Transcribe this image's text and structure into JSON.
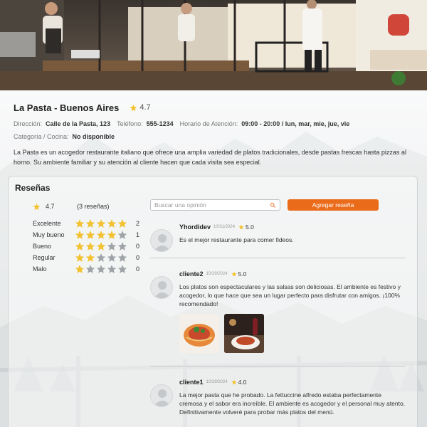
{
  "restaurant": {
    "name": "La Pasta - Buenos Aires",
    "rating": "4.7",
    "address_label": "Dirección:",
    "address": "Calle de la Pasta, 123",
    "phone_label": "Teléfono:",
    "phone": "555-1234",
    "hours_label": "Horario de Atención:",
    "hours": "09:00 - 20:00 / lun, mar, mie, jue, vie",
    "category_label": "Categoría / Cocina:",
    "category": "No disponible",
    "description": "La Pasta es un acogedor restaurante italiano que ofrece una amplia variedad de platos tradicionales, desde pastas frescas hasta pizzas al horno. Su ambiente familiar y su atención al cliente hacen que cada visita sea especial."
  },
  "reviews_section": {
    "title": "Reseñas",
    "average": "4.7",
    "count_text": "(3 reseñas)",
    "distribution": [
      {
        "label": "Excelente",
        "stars": 5,
        "count": "2"
      },
      {
        "label": "Muy bueno",
        "stars": 4,
        "count": "1"
      },
      {
        "label": "Bueno",
        "stars": 3,
        "count": "0"
      },
      {
        "label": "Regular",
        "stars": 2,
        "count": "0"
      },
      {
        "label": "Malo",
        "stars": 1,
        "count": "0"
      }
    ],
    "search_placeholder": "Buscar una opinión",
    "add_button": "Agregar reseña",
    "reviews": [
      {
        "user": "Yhordidev",
        "date": "10/31/2024",
        "rating": "5.0",
        "text": "Es el mejor restaurante para comer fideos."
      },
      {
        "user": "cliente2",
        "date": "10/29/2024",
        "rating": "5.0",
        "text": "Los platos son espectaculares y las salsas son deliciosas. El ambiente es festivo y acogedor, lo que hace que sea un lugar perfecto para disfrutar con amigos. ¡100% recomendado!"
      },
      {
        "user": "cliente1",
        "date": "10/29/2024",
        "rating": "4.0",
        "text": "La mejor pasta que he probado. La fettuccine alfredo estaba perfectamente cremosa y el sabor era increíble. El ambiente es acogedor y el personal muy atento. Definitivamente volveré para probar más platos del menú."
      }
    ]
  },
  "colors": {
    "accent": "#ea6c1b",
    "star_filled": "#f2c230",
    "star_empty": "#9ea3a7"
  },
  "icons": {
    "rating": "star-icon",
    "search": "search-icon",
    "avatar": "user-avatar-icon"
  }
}
